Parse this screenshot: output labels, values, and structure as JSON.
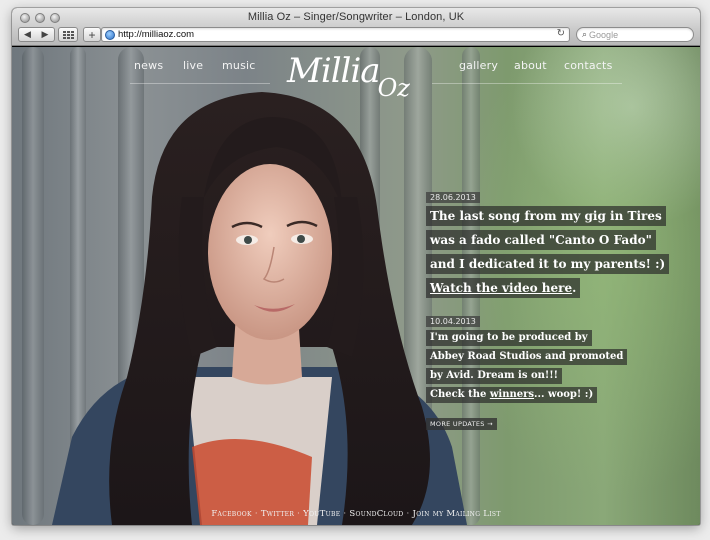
{
  "browser": {
    "title": "Millia Oz – Singer/Songwriter – London, UK",
    "url": "http://milliaoz.com",
    "search_placeholder": "Google",
    "back_glyph": "◀",
    "forward_glyph": "▶",
    "add_glyph": "+",
    "reload_glyph": "↻",
    "search_glyph": "⌕"
  },
  "site": {
    "logo_main": "Millia",
    "logo_sub": "Oz",
    "nav_left": [
      "news",
      "live",
      "music"
    ],
    "nav_right": [
      "gallery",
      "about",
      "contacts"
    ]
  },
  "posts": [
    {
      "date": "28.06.2013",
      "lines": [
        "The last song from my gig in Tires",
        "was a fado called \"Canto O Fado\"",
        "and I dedicated it to my parents! :)"
      ],
      "link_text": "Watch the video here",
      "link_suffix": "."
    },
    {
      "date": "10.04.2013",
      "lines": [
        "I'm going to be produced by",
        "Abbey Road Studios and promoted",
        "by Avid. Dream is on!!!"
      ],
      "last_prefix": "Check the ",
      "link_text": "winners",
      "link_suffix": "... woop! :)"
    }
  ],
  "more_updates": "MORE UPDATES →",
  "footer": {
    "links": [
      "Facebook",
      "Twitter",
      "YouTube",
      "SoundCloud",
      "Join my Mailing List"
    ],
    "separator": "·"
  },
  "colors": {
    "text_on_photo": "#ffffff",
    "post_bg": "#282828"
  }
}
